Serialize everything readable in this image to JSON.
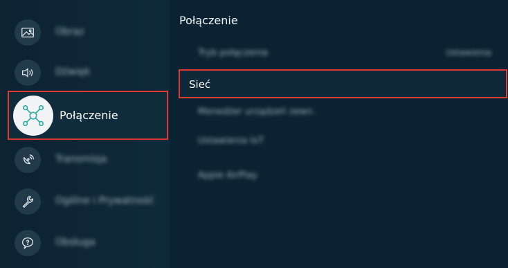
{
  "settings_menu": {
    "items": [
      {
        "label": "Obraz",
        "icon": "picture-icon"
      },
      {
        "label": "Dźwięk",
        "icon": "sound-icon"
      },
      {
        "label": "Połączenie",
        "icon": "connection-icon",
        "selected": true
      },
      {
        "label": "Transmisja",
        "icon": "broadcasting-icon"
      },
      {
        "label": "Ogólne i Prywatność",
        "icon": "wrench-icon"
      },
      {
        "label": "Obsługa",
        "icon": "support-icon"
      }
    ]
  },
  "connection_panel": {
    "title": "Połączenie",
    "rows": [
      {
        "label": "Tryb połączenia",
        "value": "Ustawienia"
      },
      {
        "label": "Sieć",
        "selected": true
      },
      {
        "label": "Menedżer urządzeń zewn."
      },
      {
        "label": "Ustawienia IoT"
      },
      {
        "label": "Apple AirPlay"
      }
    ]
  },
  "colors": {
    "highlight": "#e03b33",
    "background": "#0b2535"
  }
}
